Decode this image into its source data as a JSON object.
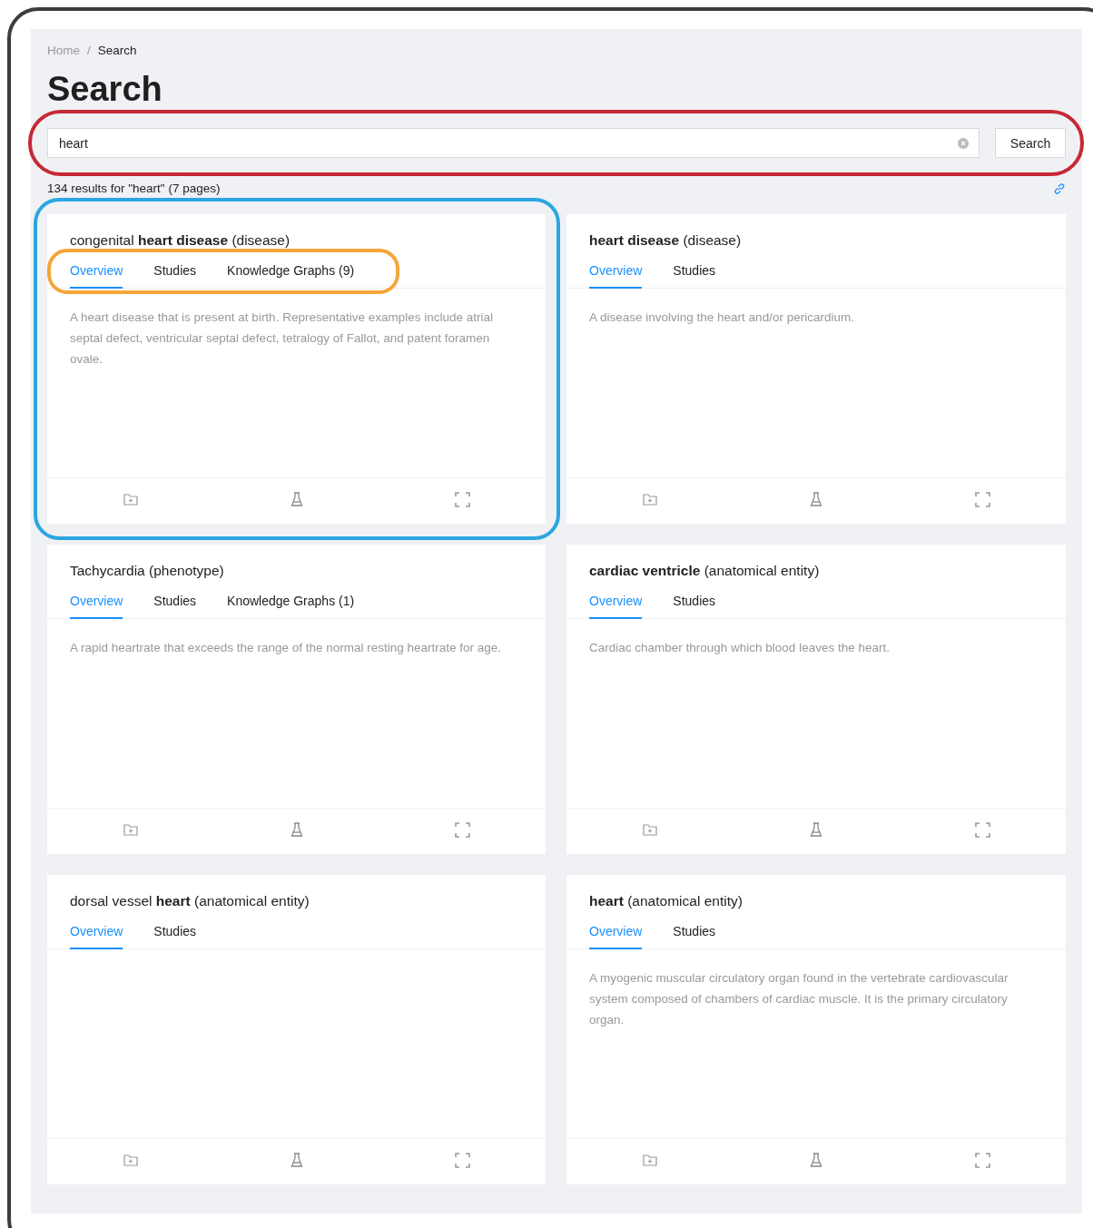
{
  "breadcrumb": [
    {
      "label": "Home",
      "current": false
    },
    {
      "label": "Search",
      "current": true
    }
  ],
  "breadcrumb_separator": "/",
  "annotations": [
    {
      "kind": "search",
      "color": "#c62a35"
    },
    {
      "kind": "card",
      "color": "#2ba6e0"
    },
    {
      "kind": "tabs",
      "color": "#f5a53a"
    }
  ],
  "title": "Search",
  "search": {
    "value": "heart",
    "button": "Search"
  },
  "results_summary": "134 results for \"heart\" (7 pages)",
  "cards": [
    {
      "title": "congenital **heart disease** (disease)",
      "tabs": [
        {
          "label": "Overview",
          "selected": true
        },
        {
          "label": "Studies",
          "selected": false
        },
        {
          "label": "Knowledge Graphs (9)",
          "selected": false
        }
      ],
      "description": "A heart disease that is present at birth. Representative examples include atrial septal defect, ventricular septal defect, tetralogy of Fallot, and patent foramen ovale."
    },
    {
      "title": "**heart disease** (disease)",
      "tabs": [
        {
          "label": "Overview",
          "selected": true
        },
        {
          "label": "Studies",
          "selected": false
        }
      ],
      "description": "A disease involving the heart and/or pericardium."
    },
    {
      "title": "Tachycardia (phenotype)",
      "tabs": [
        {
          "label": "Overview",
          "selected": true
        },
        {
          "label": "Studies",
          "selected": false
        },
        {
          "label": "Knowledge Graphs (1)",
          "selected": false
        }
      ],
      "description": "A rapid heartrate that exceeds the range of the normal resting heartrate for age."
    },
    {
      "title": "**cardiac ventricle** (anatomical entity)",
      "tabs": [
        {
          "label": "Overview",
          "selected": true
        },
        {
          "label": "Studies",
          "selected": false
        }
      ],
      "description": "Cardiac chamber through which blood leaves the heart."
    },
    {
      "title": "dorsal vessel **heart** (anatomical entity)",
      "tabs": [
        {
          "label": "Overview",
          "selected": true
        },
        {
          "label": "Studies",
          "selected": false
        }
      ]
    },
    {
      "title": "**heart** (anatomical entity)",
      "tabs": [
        {
          "label": "Overview",
          "selected": true
        },
        {
          "label": "Studies",
          "selected": false
        }
      ],
      "description": "A myogenic muscular circulatory organ found in the vertebrate cardiovascular system composed of chambers of cardiac muscle. It is the primary circulatory organ."
    }
  ]
}
